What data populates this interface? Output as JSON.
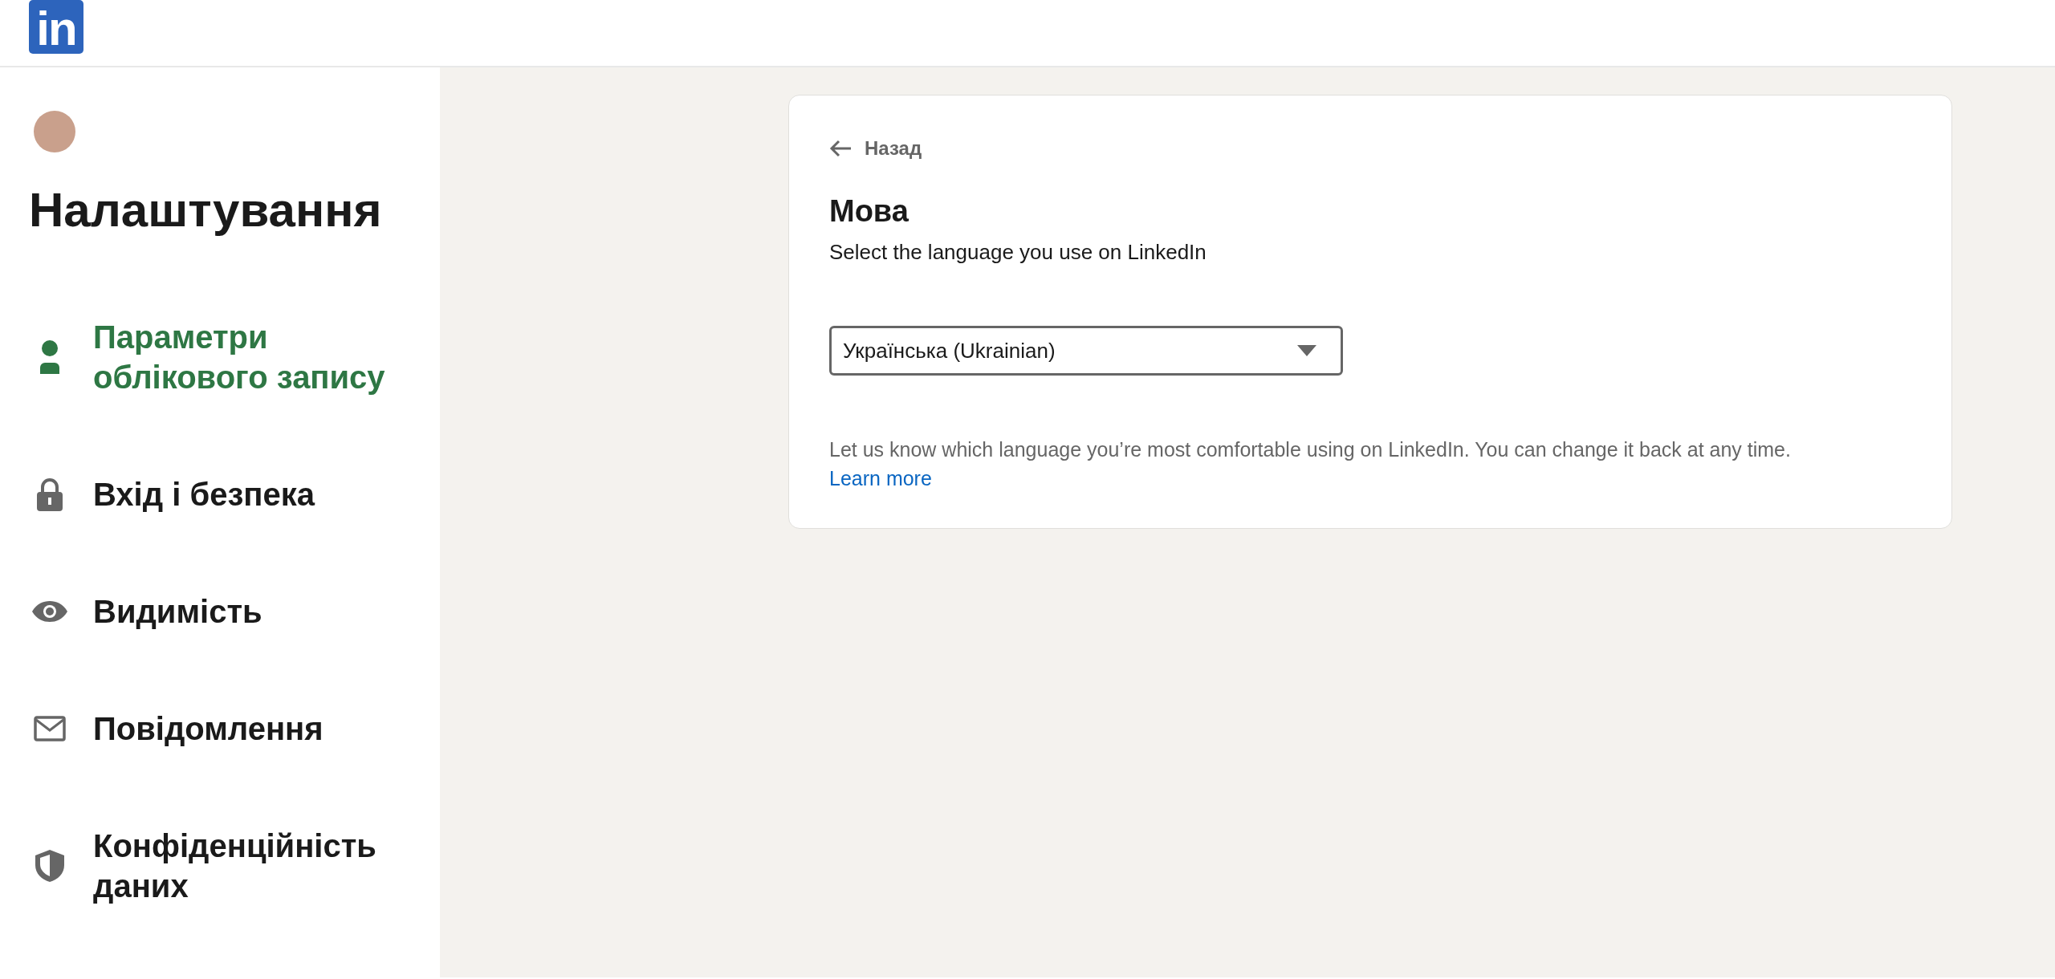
{
  "header": {
    "logo": "in"
  },
  "sidebar": {
    "title": "Налаштування",
    "items": [
      {
        "label": "Параметри облікового запису",
        "selected": true
      },
      {
        "label": "Вхід і безпека",
        "selected": false
      },
      {
        "label": "Видимість",
        "selected": false
      },
      {
        "label": "Повідомлення",
        "selected": false
      },
      {
        "label": "Конфіденційність даних",
        "selected": false
      }
    ]
  },
  "card": {
    "back": "Назад",
    "title": "Мова",
    "subtitle": "Select the language you use on LinkedIn",
    "select": {
      "value": "Українська (Ukrainian)"
    },
    "help": "Let us know which language you’re most comfortable using on LinkedIn. You can change it back at any time.",
    "link": "Learn more"
  }
}
